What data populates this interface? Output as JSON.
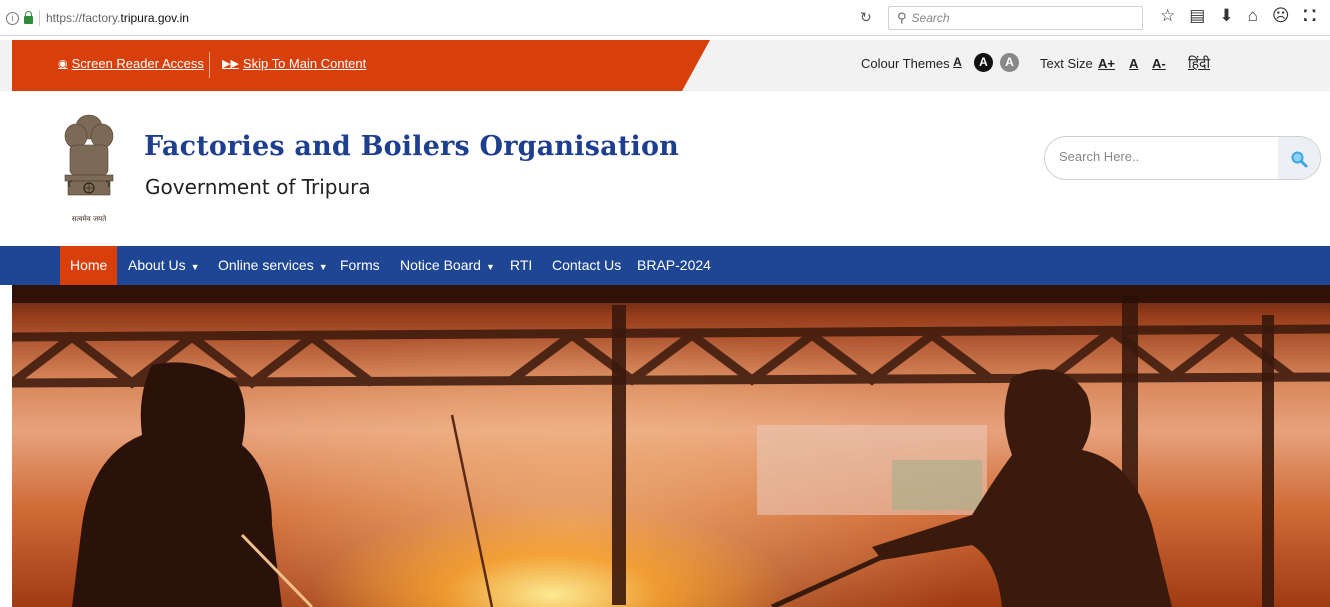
{
  "browser": {
    "url_prefix": "https://factory.",
    "url_domain": "tripura.gov.in",
    "search_placeholder": "Search",
    "icons": [
      "info-icon",
      "lock-icon",
      "reload-icon",
      "search-icon",
      "star-icon",
      "reader-icon",
      "download-icon",
      "home-icon",
      "pocket-icon",
      "shield-icon"
    ]
  },
  "topbar": {
    "screen_reader": "Screen Reader Access",
    "skip_content": "Skip To Main Content",
    "colour_themes_label": "Colour Themes",
    "theme_buttons": [
      "A",
      "A",
      "A"
    ],
    "text_size_label": "Text Size",
    "text_size_buttons": [
      "A+",
      "A",
      "A-"
    ],
    "language": "हिंदी",
    "accent_color": "#d93f0b"
  },
  "header": {
    "emblem_caption": "सत्यमेव जयते",
    "title": "Factories and Boilers Organisation",
    "subtitle": "Government of Tripura",
    "search_placeholder": "Search Here.."
  },
  "nav": {
    "color": "#1e4694",
    "items": [
      {
        "label": "Home",
        "active": true
      },
      {
        "label": "About Us",
        "dropdown": true
      },
      {
        "label": "Online services",
        "dropdown": true
      },
      {
        "label": "Forms"
      },
      {
        "label": "Notice Board",
        "dropdown": true
      },
      {
        "label": "RTI"
      },
      {
        "label": "Contact Us"
      },
      {
        "label": "BRAP-2024"
      }
    ]
  }
}
